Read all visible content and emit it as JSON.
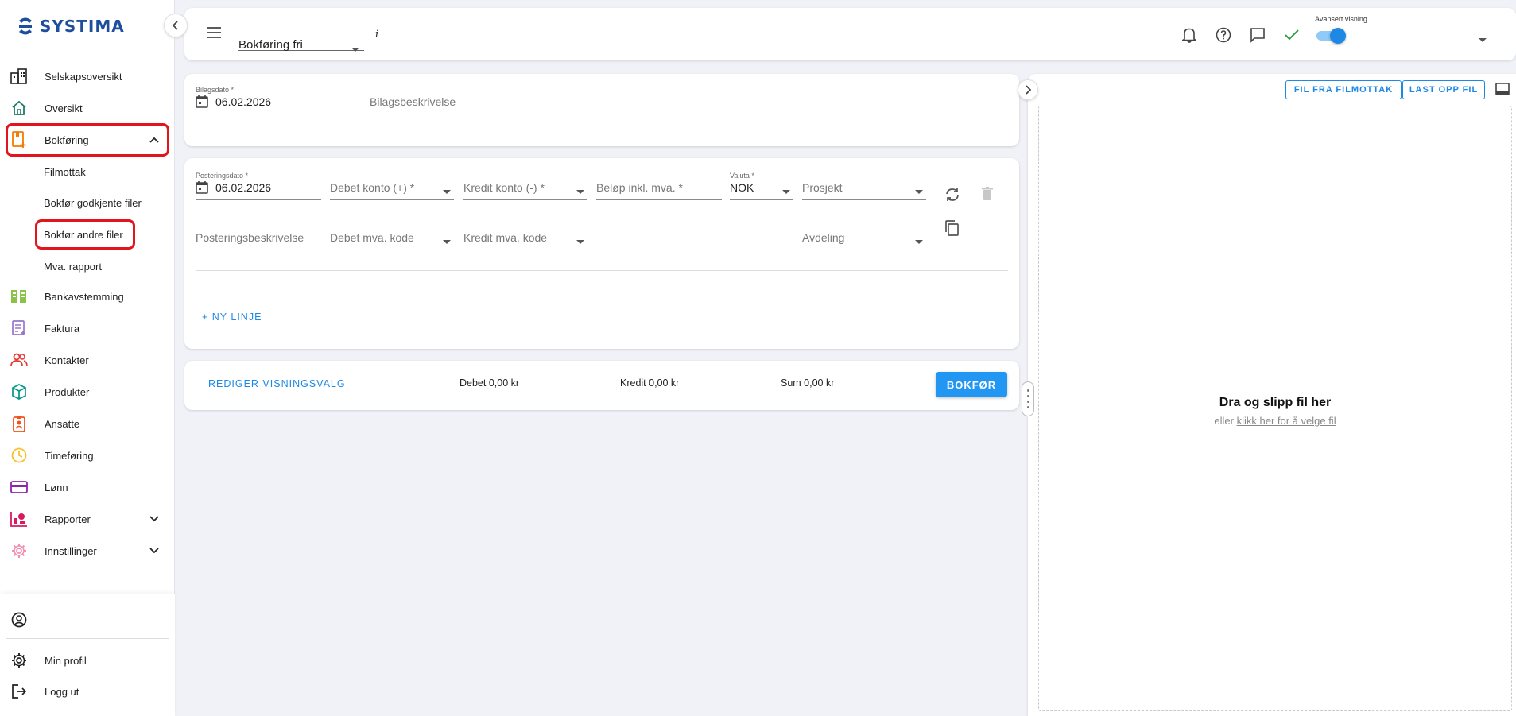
{
  "brand": {
    "name": "SYSTIMA",
    "color": "#1d4f9c"
  },
  "sidebar": {
    "items": [
      {
        "label": "Selskapsoversikt",
        "icon": "building-icon"
      },
      {
        "label": "Oversikt",
        "icon": "home-icon"
      },
      {
        "label": "Bokføring",
        "icon": "bookkeeping-icon",
        "expanded": true
      },
      {
        "label": "Bankavstemming",
        "icon": "bank-reconciliation-icon"
      },
      {
        "label": "Faktura",
        "icon": "invoice-icon"
      },
      {
        "label": "Kontakter",
        "icon": "contacts-icon"
      },
      {
        "label": "Produkter",
        "icon": "product-box-icon"
      },
      {
        "label": "Ansatte",
        "icon": "employee-badge-icon"
      },
      {
        "label": "Timeføring",
        "icon": "clock-icon"
      },
      {
        "label": "Lønn",
        "icon": "card-icon"
      },
      {
        "label": "Rapporter",
        "icon": "reports-icon"
      },
      {
        "label": "Innstillinger",
        "icon": "settings-gear-icon"
      }
    ],
    "subitems": [
      {
        "label": "Filmottak"
      },
      {
        "label": "Bokfør godkjente filer"
      },
      {
        "label": "Bokfør andre filer"
      },
      {
        "label": "Mva. rapport"
      }
    ],
    "bottom": [
      {
        "label": "",
        "icon": "account-circle-icon"
      },
      {
        "label": "Min profil",
        "icon": "gear-icon"
      },
      {
        "label": "Logg ut",
        "icon": "logout-icon"
      }
    ]
  },
  "topbar": {
    "mode": "Bokføring fri",
    "info": "i",
    "advanced_label": "Avansert visning",
    "advanced_on": true
  },
  "voucher": {
    "date_label": "Bilagsdato *",
    "date_value": "06.02.2026",
    "description_placeholder": "Bilagsbeskrivelse"
  },
  "posting": {
    "date_label": "Posteringsdato *",
    "date_value": "06.02.2026",
    "debet_account": "Debet konto (+) *",
    "kredit_account": "Kredit konto (-) *",
    "amount": "Beløp inkl. mva. *",
    "currency_label": "Valuta *",
    "currency_value": "NOK",
    "project": "Prosjekt",
    "description": "Posteringsbeskrivelse",
    "debet_vat": "Debet mva. kode",
    "kredit_vat": "Kredit mva. kode",
    "department": "Avdeling",
    "new_line": "+ NY LINJE"
  },
  "summary": {
    "edit_view": "REDIGER VISNINGSVALG",
    "debet": "Debet 0,00 kr",
    "kredit": "Kredit 0,00 kr",
    "sum": "Sum 0,00 kr",
    "submit": "BOKFØR"
  },
  "files": {
    "from_inbox": "FIL FRA FILMOTTAK",
    "upload": "LAST OPP FIL",
    "drop_title": "Dra og slipp fil her",
    "drop_or": "eller",
    "drop_link": "klikk her for å velge fil"
  },
  "colors": {
    "accent": "#1e88e5",
    "highlight": "#e2141c",
    "success": "#2e9f4a"
  }
}
